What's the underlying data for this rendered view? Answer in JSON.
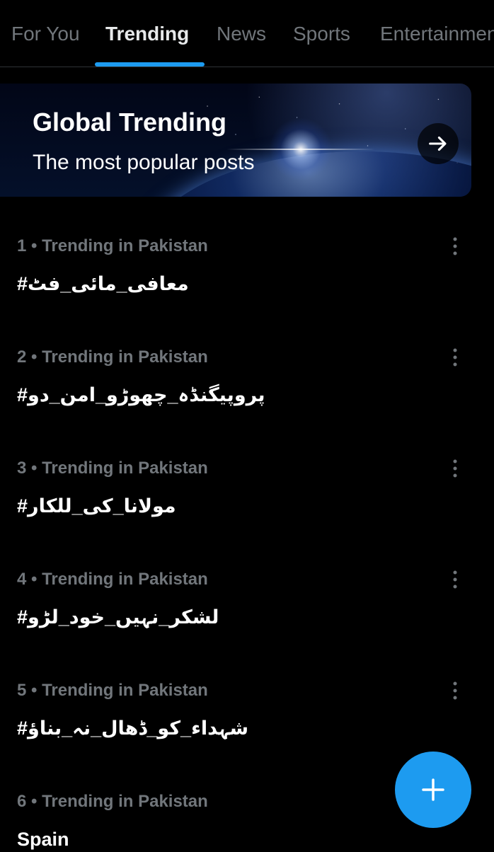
{
  "tabs": [
    {
      "label": "For You",
      "active": false
    },
    {
      "label": "Trending",
      "active": true
    },
    {
      "label": "News",
      "active": false
    },
    {
      "label": "Sports",
      "active": false
    },
    {
      "label": "Entertainment",
      "active": false
    }
  ],
  "banner": {
    "title": "Global Trending",
    "subtitle": "The most popular posts",
    "arrow_icon": "arrow-right-icon"
  },
  "trends": [
    {
      "meta": "1 • Trending in Pakistan",
      "name": "#معافی_مائی_فٹ"
    },
    {
      "meta": "2 • Trending in Pakistan",
      "name": "#پروپیگنڈہ_چھوڑو_امن_دو"
    },
    {
      "meta": "3 • Trending in Pakistan",
      "name": "#مولانا_کی_للکار"
    },
    {
      "meta": "4 • Trending in Pakistan",
      "name": "#لشکر_نہیں_خود_لڑو"
    },
    {
      "meta": "5 • Trending in Pakistan",
      "name": "#شہداء_کو_ڈھال_نہ_بناؤ"
    },
    {
      "meta": "6 • Trending in Pakistan",
      "name": "Spain"
    }
  ],
  "fab": {
    "icon": "plus-icon"
  },
  "colors": {
    "background": "#000000",
    "accent": "#1d9bf0",
    "muted_text": "#71767b",
    "primary_text": "#e7e9ea",
    "divider": "#2f3336"
  }
}
